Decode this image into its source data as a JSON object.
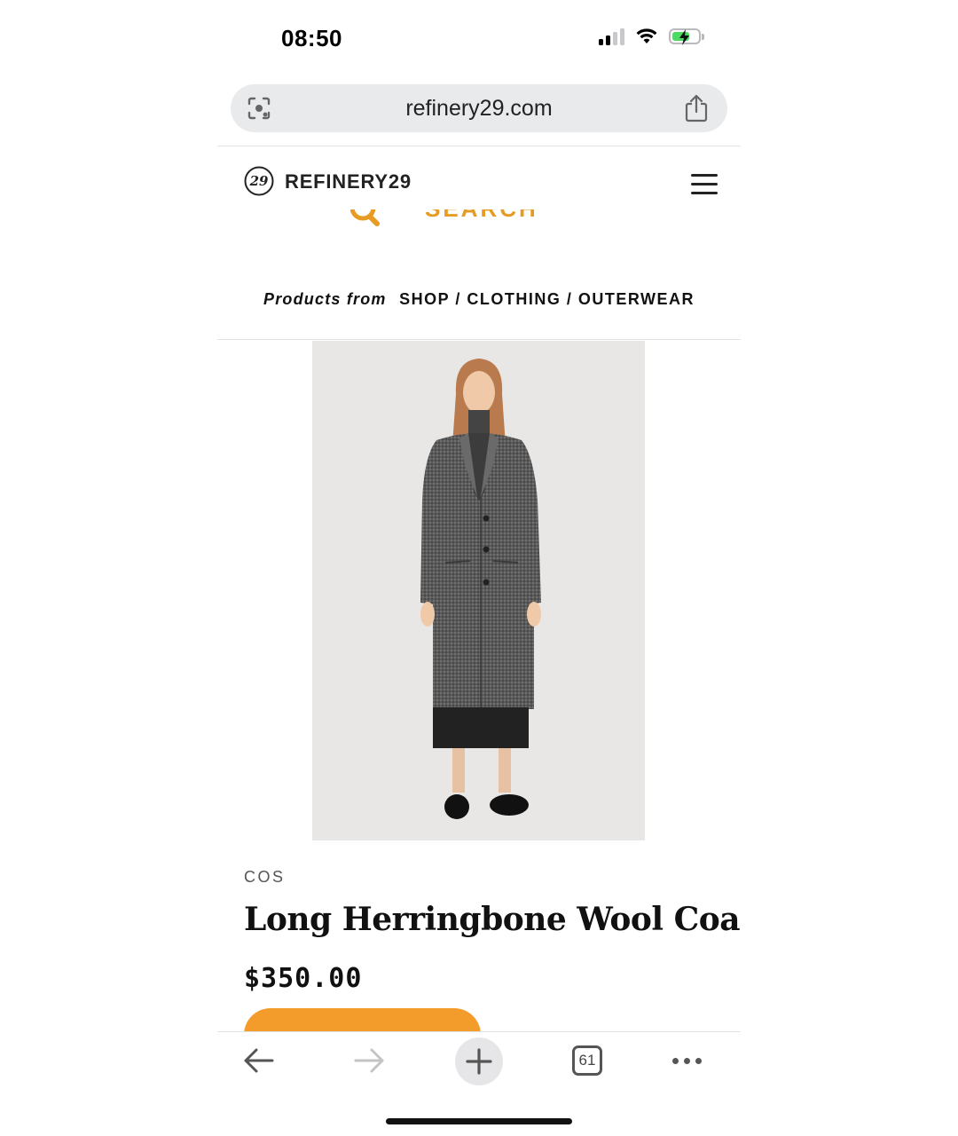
{
  "status_bar": {
    "time": "08:50"
  },
  "browser": {
    "url": "refinery29.com",
    "tab_count": "61"
  },
  "site": {
    "name": "REFINERY29",
    "search_label": "SEARCH"
  },
  "breadcrumb": {
    "prefix": "Products from",
    "path": "SHOP / CLOTHING / OUTERWEAR"
  },
  "product": {
    "brand": "COS",
    "title": "Long Herringbone Wool Coat",
    "price": "$350.00"
  },
  "colors": {
    "accent": "#f39c2b",
    "search_orange": "#e89b23",
    "url_bar_bg": "#e9eaec"
  },
  "icons": {
    "camera_search": "camera-lens-icon",
    "share": "share-icon",
    "logo": "r29-logo-icon",
    "menu": "hamburger-menu-icon",
    "back": "arrow-left-icon",
    "forward": "arrow-right-icon",
    "new_tab": "plus-icon",
    "tabs": "tabs-icon",
    "more": "more-dots-icon"
  }
}
